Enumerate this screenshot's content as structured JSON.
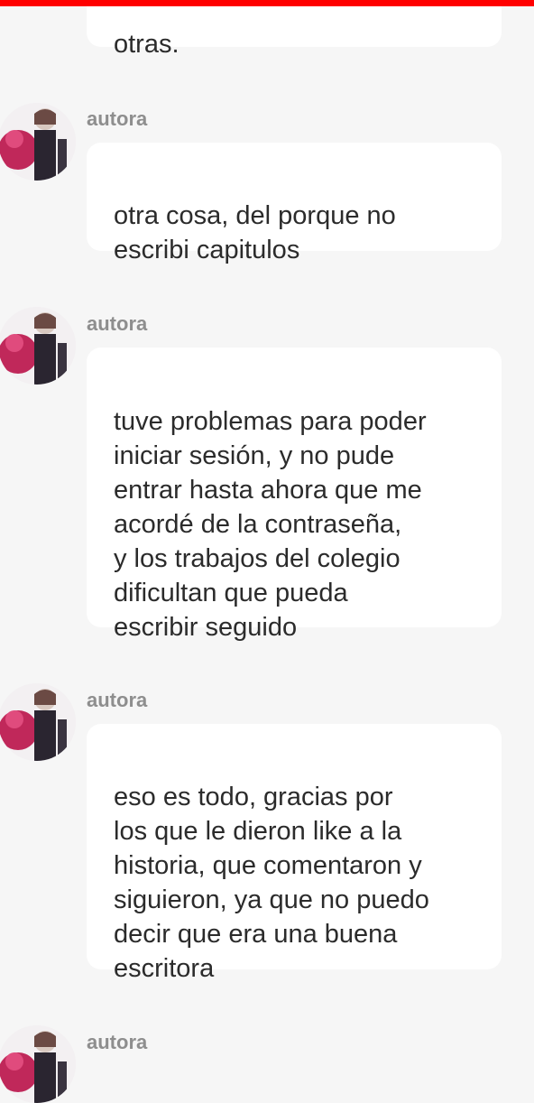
{
  "messages": [
    {
      "text": "otras."
    },
    {
      "author": "autora",
      "text": "otra cosa, del porque no\nescribi capitulos"
    },
    {
      "author": "autora",
      "text": "tuve problemas para poder\niniciar sesión, y no pude\nentrar hasta ahora que me\nacordé de la contraseña,\ny los trabajos del colegio\ndificultan que pueda\nescribir seguido"
    },
    {
      "author": "autora",
      "text": "eso es todo, gracias por\nlos que le dieron like a la\nhistoria, que comentaron y\nsiguieron, ya que no puedo\ndecir que era una buena\nescritora"
    },
    {
      "author": "autora"
    }
  ],
  "colors": {
    "top_accent": "#ff0000",
    "background": "#f6f6f6",
    "bubble": "#ffffff",
    "author_text": "#8e8e8e",
    "message_text": "#2b2b2b"
  },
  "icons": {
    "avatar": "anime-illustration-avatar"
  }
}
